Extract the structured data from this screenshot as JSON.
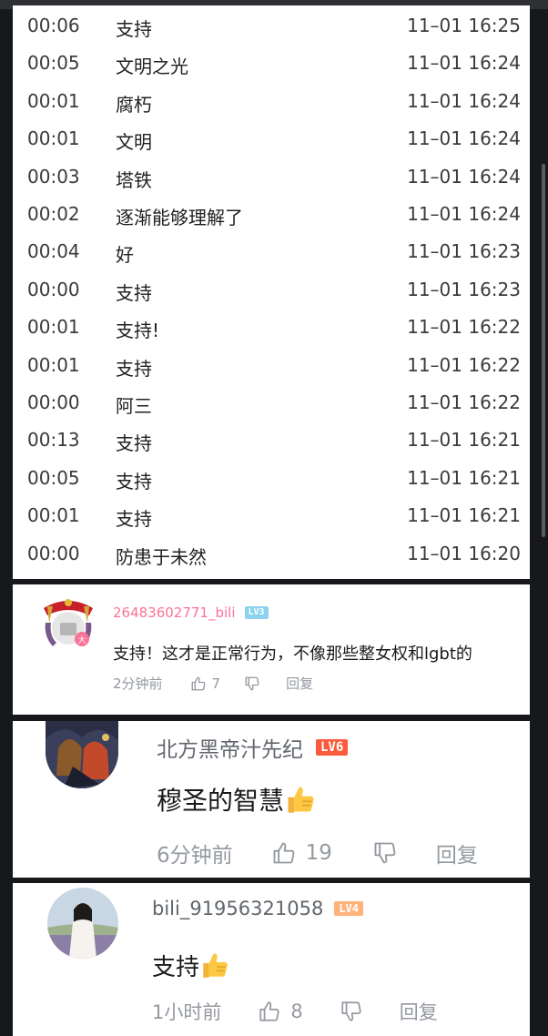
{
  "danmaku": [
    {
      "time": "00:06",
      "text": "支持",
      "date": "11–01 16:25"
    },
    {
      "time": "00:05",
      "text": "文明之光",
      "date": "11–01 16:24"
    },
    {
      "time": "00:01",
      "text": "腐朽",
      "date": "11–01 16:24"
    },
    {
      "time": "00:01",
      "text": "文明",
      "date": "11–01 16:24"
    },
    {
      "time": "00:03",
      "text": "塔铁",
      "date": "11–01 16:24"
    },
    {
      "time": "00:02",
      "text": "逐渐能够理解了",
      "date": "11–01 16:24"
    },
    {
      "time": "00:04",
      "text": "好",
      "date": "11–01 16:23"
    },
    {
      "time": "00:00",
      "text": "支持",
      "date": "11–01 16:23"
    },
    {
      "time": "00:01",
      "text": "支持!",
      "date": "11–01 16:22"
    },
    {
      "time": "00:01",
      "text": "支持",
      "date": "11–01 16:22"
    },
    {
      "time": "00:00",
      "text": "阿三",
      "date": "11–01 16:22"
    },
    {
      "time": "00:13",
      "text": "支持",
      "date": "11–01 16:21"
    },
    {
      "time": "00:05",
      "text": "支持",
      "date": "11–01 16:21"
    },
    {
      "time": "00:01",
      "text": "支持",
      "date": "11–01 16:21"
    },
    {
      "time": "00:00",
      "text": "防患于未然",
      "date": "11–01 16:20"
    }
  ],
  "comments": [
    {
      "username": "26483602771_bili",
      "level": "LV3",
      "content": "支持！这才是正常行为，不像那些整女权和lgbt的",
      "time": "2分钟前",
      "likes": "7",
      "reply": "回复"
    },
    {
      "username": "北方黑帝汁先纪",
      "level": "LV6",
      "content": "穆圣的智慧",
      "emoji": "👍",
      "time": "6分钟前",
      "likes": "19",
      "reply": "回复"
    },
    {
      "username": "bili_91956321058",
      "level": "LV4",
      "content": "支持",
      "emoji": "👍",
      "time": "1小时前",
      "likes": "8",
      "reply": "回复"
    }
  ],
  "colors": {
    "username_pink": "#fb7299",
    "lv3": "#8dd3ef",
    "lv6": "#fb5a3c",
    "lv4": "#ffb27a",
    "meta_gray": "#9499a0"
  },
  "icons": {
    "like": "thumb-up-outline-icon",
    "dislike": "thumb-down-outline-icon",
    "emoji": "thumbs-up-emoji"
  }
}
